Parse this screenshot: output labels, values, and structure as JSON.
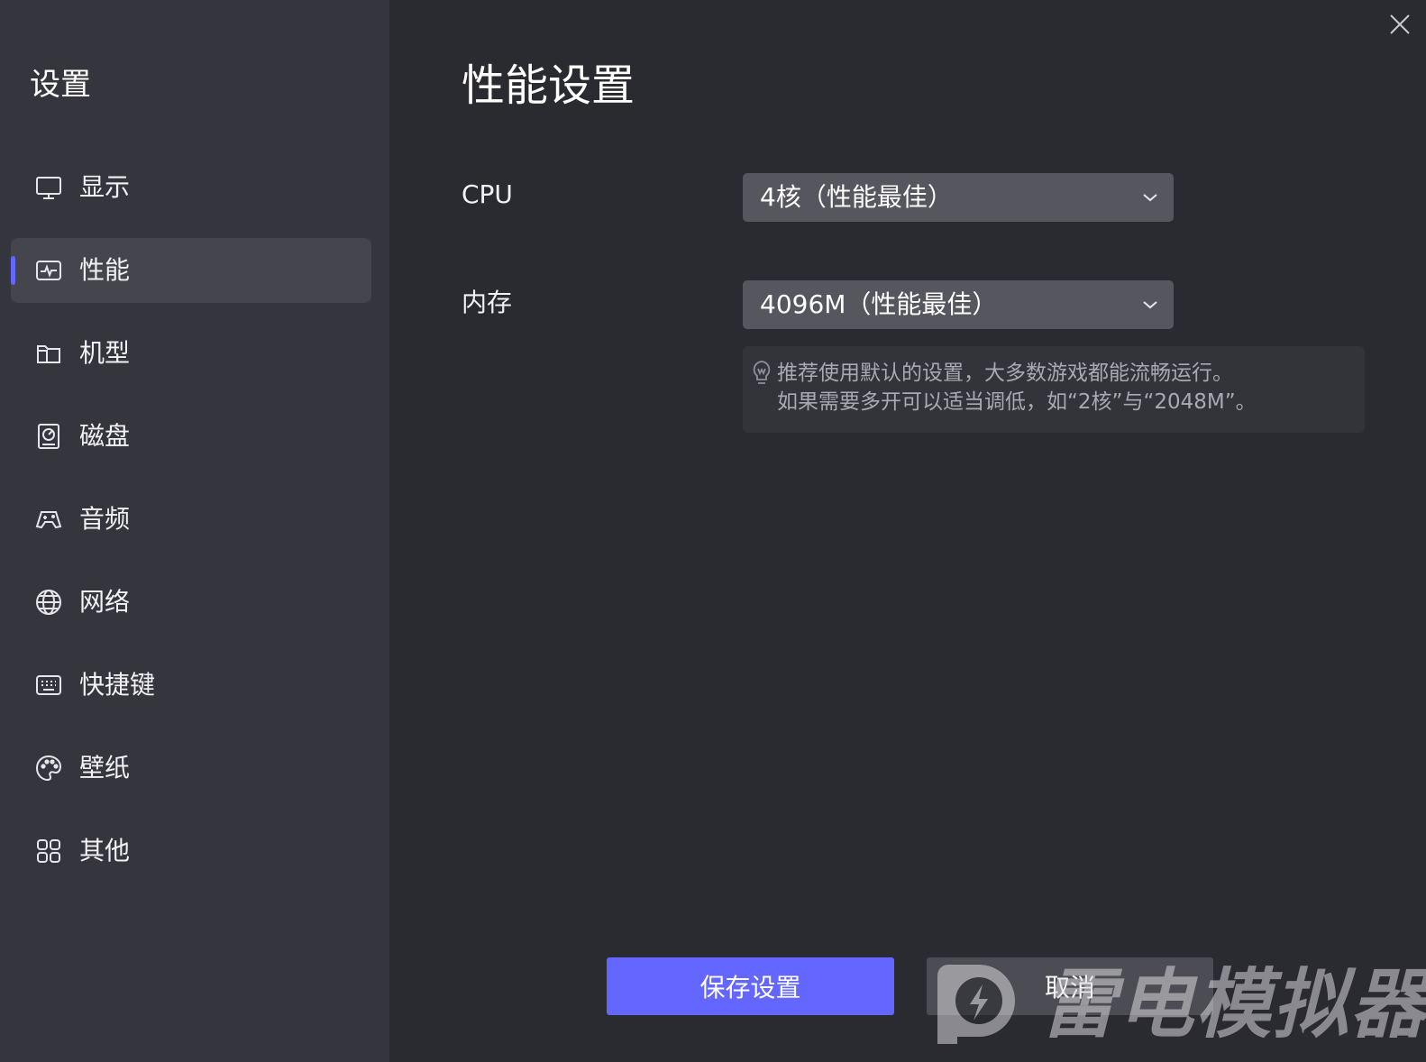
{
  "sidebar": {
    "title": "设置",
    "items": [
      {
        "label": "显示",
        "icon": "monitor-icon",
        "active": false
      },
      {
        "label": "性能",
        "icon": "performance-icon",
        "active": true
      },
      {
        "label": "机型",
        "icon": "folder-icon",
        "active": false
      },
      {
        "label": "磁盘",
        "icon": "disk-icon",
        "active": false
      },
      {
        "label": "音频",
        "icon": "gamepad-icon",
        "active": false
      },
      {
        "label": "网络",
        "icon": "globe-icon",
        "active": false
      },
      {
        "label": "快捷键",
        "icon": "keyboard-icon",
        "active": false
      },
      {
        "label": "壁纸",
        "icon": "palette-icon",
        "active": false
      },
      {
        "label": "其他",
        "icon": "grid-icon",
        "active": false
      }
    ]
  },
  "main": {
    "title": "性能设置",
    "cpu": {
      "label": "CPU",
      "value": "4核（性能最佳）"
    },
    "memory": {
      "label": "内存",
      "value": "4096M（性能最佳）"
    },
    "hint": {
      "line1": "推荐使用默认的设置，大多数游戏都能流畅运行。",
      "line2": "如果需要多开可以适当调低，如“2核”与“2048M”。"
    }
  },
  "footer": {
    "save_label": "保存设置",
    "cancel_label": "取消"
  },
  "watermark": {
    "text": "雷电模拟器"
  },
  "colors": {
    "accent": "#6366ff",
    "sidebar_bg": "#35353d",
    "main_bg": "#2a2a31",
    "select_bg": "#56565e"
  }
}
